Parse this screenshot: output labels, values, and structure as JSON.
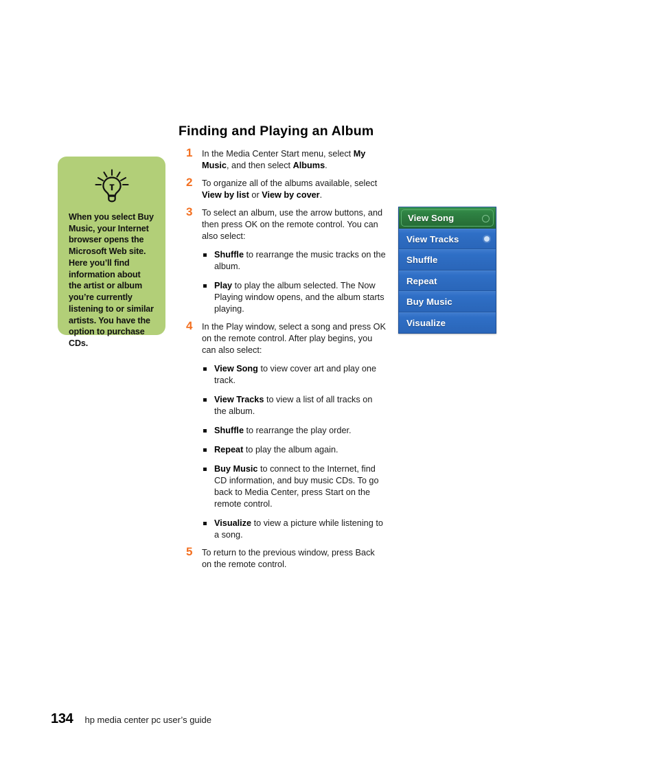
{
  "page": {
    "title": "Finding and Playing an Album"
  },
  "tip": {
    "icon": "lightbulb-icon",
    "text": "When you select Buy Music, your Internet browser opens the Microsoft Web site. Here you’ll find information about the artist or album you’re currently listening to or similar artists. You have the option to purchase CDs.",
    "background_color": "#b2cf78"
  },
  "steps": [
    {
      "number": "1",
      "parts": [
        {
          "text": "In the Media Center Start menu, select ",
          "bold": false
        },
        {
          "text": "My Music",
          "bold": true
        },
        {
          "text": ", and then select ",
          "bold": false
        },
        {
          "text": "Albums",
          "bold": true
        },
        {
          "text": ".",
          "bold": false
        }
      ],
      "sublist": []
    },
    {
      "number": "2",
      "parts": [
        {
          "text": "To organize all of the albums available, select ",
          "bold": false
        },
        {
          "text": "View by list",
          "bold": true
        },
        {
          "text": " or ",
          "bold": false
        },
        {
          "text": "View by cover",
          "bold": true
        },
        {
          "text": ".",
          "bold": false
        }
      ],
      "sublist": []
    },
    {
      "number": "3",
      "parts": [
        {
          "text": "To select an album, use the arrow buttons, and then press OK on the remote control. You can also select:",
          "bold": false
        }
      ],
      "sublist": [
        [
          {
            "text": "Shuffle",
            "bold": true
          },
          {
            "text": " to rearrange the music tracks on the album.",
            "bold": false
          }
        ],
        [
          {
            "text": "Play",
            "bold": true
          },
          {
            "text": " to play the album selected. The Now Playing window opens, and the album starts playing.",
            "bold": false
          }
        ]
      ]
    },
    {
      "number": "4",
      "parts": [
        {
          "text": "In the Play window, select a song and press OK on the remote control. After play begins, you can also select:",
          "bold": false
        }
      ],
      "sublist": [
        [
          {
            "text": "View Song",
            "bold": true
          },
          {
            "text": " to view cover art and play one track.",
            "bold": false
          }
        ],
        [
          {
            "text": "View Tracks",
            "bold": true
          },
          {
            "text": " to view a list of all tracks on the album.",
            "bold": false
          }
        ],
        [
          {
            "text": "Shuffle",
            "bold": true
          },
          {
            "text": " to rearrange the play order.",
            "bold": false
          }
        ],
        [
          {
            "text": "Repeat",
            "bold": true
          },
          {
            "text": " to play the album again.",
            "bold": false
          }
        ],
        [
          {
            "text": "Buy Music",
            "bold": true
          },
          {
            "text": " to connect to the Internet, find CD information, and buy music CDs. To go back to Media Center, press Start on the remote control.",
            "bold": false
          }
        ],
        [
          {
            "text": "Visualize",
            "bold": true
          },
          {
            "text": " to view a picture while listening to a song.",
            "bold": false
          }
        ]
      ]
    },
    {
      "number": "5",
      "parts": [
        {
          "text": "To return to the previous window, press Back on the remote control.",
          "bold": false
        }
      ],
      "sublist": []
    }
  ],
  "media_center_menu": {
    "selected_color": "#2f8243",
    "background_color": "#2f6fc6",
    "items": [
      {
        "label": "View Song",
        "selected": true,
        "indicator": "hollow"
      },
      {
        "label": "View Tracks",
        "selected": false,
        "indicator": "filled"
      },
      {
        "label": "Shuffle",
        "selected": false,
        "indicator": "none"
      },
      {
        "label": "Repeat",
        "selected": false,
        "indicator": "none"
      },
      {
        "label": "Buy Music",
        "selected": false,
        "indicator": "none"
      },
      {
        "label": "Visualize",
        "selected": false,
        "indicator": "none"
      }
    ]
  },
  "footer": {
    "page_number": "134",
    "guide_label": "hp media center pc user’s guide"
  },
  "colors": {
    "step_number": "#f37021",
    "tip_green": "#b2cf78",
    "menu_blue": "#2f6fc6",
    "menu_green": "#2f8243"
  }
}
